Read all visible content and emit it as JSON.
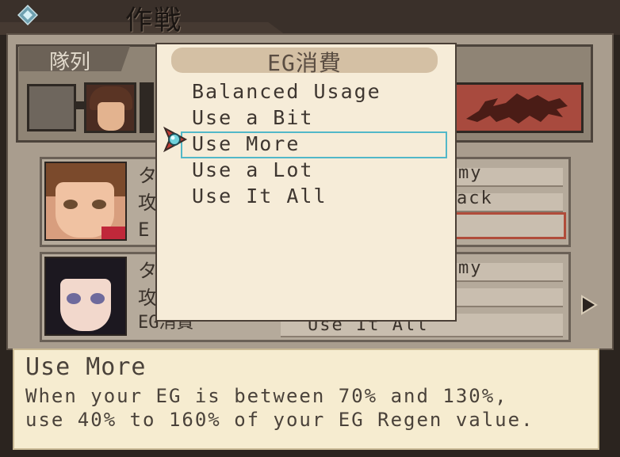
{
  "header": {
    "title": "作戦",
    "diamond_icon": "diamond-icon"
  },
  "formation": {
    "label": "隊列"
  },
  "dropdown": {
    "title": "EG消費",
    "options": [
      {
        "label": "Balanced Usage"
      },
      {
        "label": "Use a Bit"
      },
      {
        "label": "Use More",
        "selected": true
      },
      {
        "label": "Use a Lot"
      },
      {
        "label": "Use It All"
      }
    ],
    "highlight_color": "#52b8c8"
  },
  "characters": [
    {
      "fields": [
        {
          "label": "タ",
          "value": "my"
        },
        {
          "label": "攻",
          "value": "ack"
        },
        {
          "label": "E",
          "value": ""
        }
      ]
    },
    {
      "fields": [
        {
          "label": "タ",
          "value": "my"
        },
        {
          "label": "攻",
          "value": ""
        },
        {
          "label": "EG消費",
          "value": "Use It All"
        }
      ]
    }
  ],
  "help": {
    "title": "Use More",
    "line1": "When your EG is between 70% and 130%,",
    "line2": "use 40% to 160% of your EG Regen value."
  },
  "colors": {
    "background": "#2b241f",
    "dropdown_bg": "#f6ecd8",
    "help_bg": "#f6ecd0",
    "enemy_panel": "#a84a3e"
  }
}
